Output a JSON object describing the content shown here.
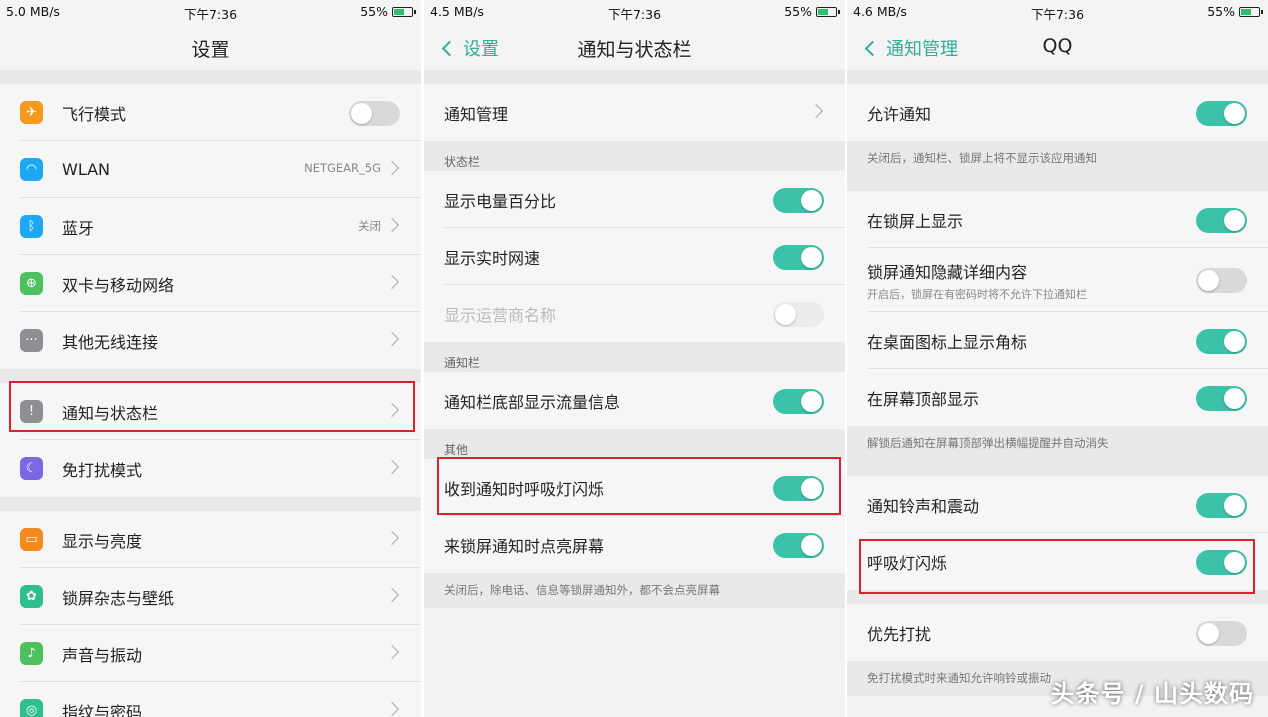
{
  "colors": {
    "accent": "#3cc2a8",
    "highlight": "#d9232f"
  },
  "panel1": {
    "status": {
      "speed": "5.0 MB/s",
      "time": "下午7:36",
      "battery": "55%"
    },
    "title": "设置",
    "items": [
      {
        "label": "飞行模式",
        "icon": "airplane-icon",
        "color": "#f39a1e"
      },
      {
        "label": "WLAN",
        "value": "NETGEAR_5G",
        "icon": "wifi-icon",
        "color": "#1ea8f3"
      },
      {
        "label": "蓝牙",
        "value": "关闭",
        "icon": "bluetooth-icon",
        "color": "#1ea8f3"
      },
      {
        "label": "双卡与移动网络",
        "icon": "globe-icon",
        "color": "#4cc15e"
      },
      {
        "label": "其他无线连接",
        "icon": "more-icon",
        "color": "#8e8e93"
      },
      {
        "label": "通知与状态栏",
        "icon": "exclamation-icon",
        "color": "#8e8e93"
      },
      {
        "label": "免打扰模式",
        "icon": "moon-icon",
        "color": "#7b66e3"
      },
      {
        "label": "显示与亮度",
        "icon": "display-icon",
        "color": "#f38a1e"
      },
      {
        "label": "锁屏杂志与壁纸",
        "icon": "flower-icon",
        "color": "#2fbf8f"
      },
      {
        "label": "声音与振动",
        "icon": "speaker-icon",
        "color": "#4cc15e"
      },
      {
        "label": "指纹与密码",
        "icon": "fingerprint-icon",
        "color": "#2fbf8f"
      }
    ]
  },
  "panel2": {
    "status": {
      "speed": "4.5 MB/s",
      "time": "下午7:36",
      "battery": "55%"
    },
    "back": "设置",
    "title": "通知与状态栏",
    "notif_mgmt": "通知管理",
    "section_status": "状态栏",
    "battery_pct": "显示电量百分比",
    "net_speed": "显示实时网速",
    "carrier": "显示运营商名称",
    "section_notif": "通知栏",
    "traffic": "通知栏底部显示流量信息",
    "section_other": "其他",
    "breath": "收到通知时呼吸灯闪烁",
    "wake": "来锁屏通知时点亮屏幕",
    "note": "关闭后，除电话、信息等锁屏通知外，都不会点亮屏幕"
  },
  "panel3": {
    "status": {
      "speed": "4.6 MB/s",
      "time": "下午7:36",
      "battery": "55%"
    },
    "back": "通知管理",
    "title": "QQ",
    "allow": "允许通知",
    "allow_note": "关闭后，通知栏、锁屏上将不显示该应用通知",
    "lock_show": "在锁屏上显示",
    "lock_hide": "锁屏通知隐藏详细内容",
    "lock_hide_sub": "开启后，锁屏在有密码时将不允许下拉通知栏",
    "badge": "在桌面图标上显示角标",
    "top_show": "在屏幕顶部显示",
    "top_note": "解锁后通知在屏幕顶部弹出横幅提醒并自动消失",
    "ring": "通知铃声和震动",
    "breath": "呼吸灯闪烁",
    "priority": "优先打扰",
    "priority_note": "免打扰模式时来通知允许响铃或振动"
  },
  "watermark": "头条号 / 山头数码"
}
